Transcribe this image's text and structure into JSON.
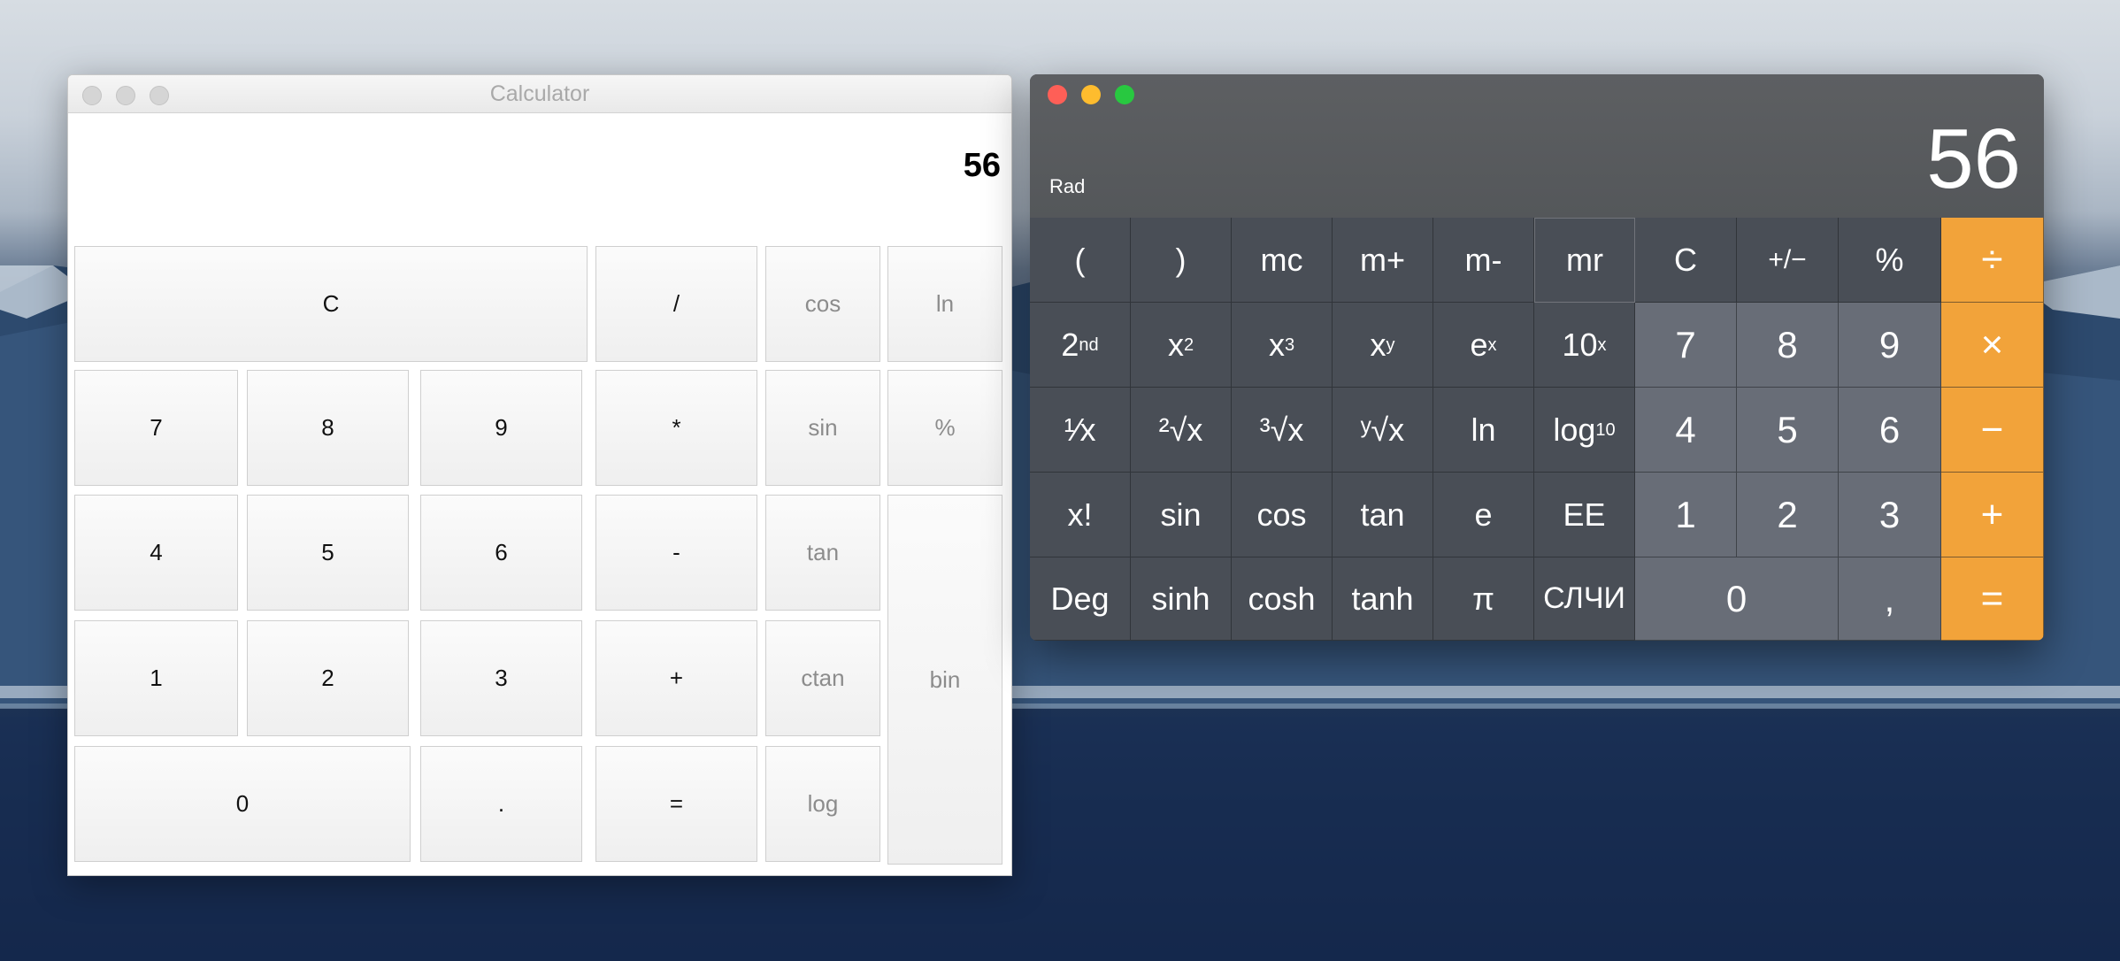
{
  "left_window": {
    "title": "Calculator",
    "display": "56",
    "buttons": {
      "clear": "C",
      "divide": "/",
      "cos": "cos",
      "ln": "ln",
      "seven": "7",
      "eight": "8",
      "nine": "9",
      "multiply": "*",
      "sin": "sin",
      "percent": "%",
      "four": "4",
      "five": "5",
      "six": "6",
      "minus": "-",
      "tan": "tan",
      "bin": "bin",
      "one": "1",
      "two": "2",
      "three": "3",
      "plus": "+",
      "ctan": "ctan",
      "zero": "0",
      "dot": ".",
      "equals": "=",
      "log": "log"
    }
  },
  "right_window": {
    "mode": "Rad",
    "display": "56",
    "row1": {
      "lparen": "(",
      "rparen": ")",
      "mc": "mc",
      "mplus": "m+",
      "mminus": "m-",
      "mr": "mr",
      "clear": "C",
      "plusminus_base": "+/−",
      "percent": "%",
      "divide": "÷"
    },
    "row2": {
      "second_base": "2",
      "second_sup": "nd",
      "square_base": "x",
      "square_sup": "2",
      "cube_base": "x",
      "cube_sup": "3",
      "power_base": "x",
      "power_sup": "y",
      "exp_base": "e",
      "exp_sup": "x",
      "ten_base": "10",
      "ten_sup": "x",
      "seven": "7",
      "eight": "8",
      "nine": "9",
      "multiply": "×"
    },
    "row3": {
      "reciprocal": "¹⁄x",
      "sqrt": "²√x",
      "cbrt": "³√x",
      "yroot": "ʸ√x",
      "ln": "ln",
      "log_base": "log",
      "log_sub": "10",
      "four": "4",
      "five": "5",
      "six": "6",
      "minus": "−"
    },
    "row4": {
      "factorial": "x!",
      "sin": "sin",
      "cos": "cos",
      "tan": "tan",
      "e": "e",
      "ee": "EE",
      "one": "1",
      "two": "2",
      "three": "3",
      "plus": "+"
    },
    "row5": {
      "deg": "Deg",
      "sinh": "sinh",
      "cosh": "cosh",
      "tanh": "tanh",
      "pi": "π",
      "rand": "СЛЧИ",
      "zero": "0",
      "comma": ",",
      "equals": "="
    }
  }
}
